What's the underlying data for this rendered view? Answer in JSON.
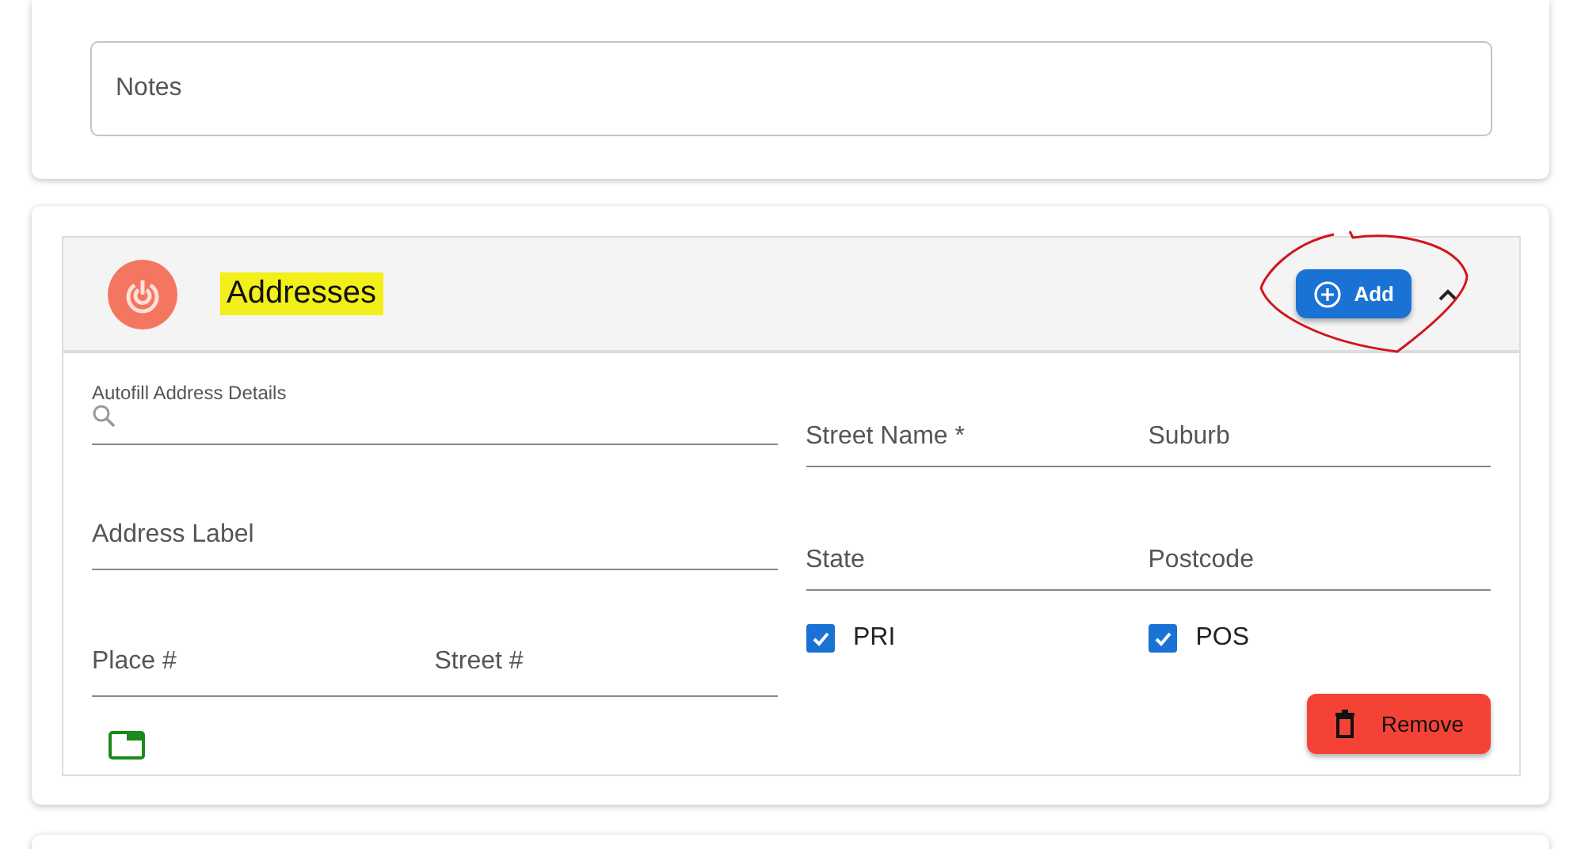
{
  "notes_card": {
    "notes": {
      "placeholder": "Notes"
    }
  },
  "addresses": {
    "title": "Addresses",
    "title_highlighted": true,
    "add_button": "Add",
    "add_button_circled": true,
    "expanded": true,
    "autofill": {
      "label": "Autofill Address Details"
    },
    "left_fields": [
      {
        "placeholder": "Address Label"
      }
    ],
    "number_fields": [
      {
        "placeholder": "Place #"
      },
      {
        "placeholder": "Street #"
      }
    ],
    "right_rows": [
      [
        {
          "placeholder": "Street Name *"
        },
        {
          "placeholder": "Suburb"
        }
      ],
      [
        {
          "placeholder": "State"
        },
        {
          "placeholder": "Postcode"
        }
      ]
    ],
    "checkboxes": [
      {
        "label": "PRI",
        "checked": true
      },
      {
        "label": "POS",
        "checked": true
      }
    ],
    "remove_button": "Remove"
  }
}
